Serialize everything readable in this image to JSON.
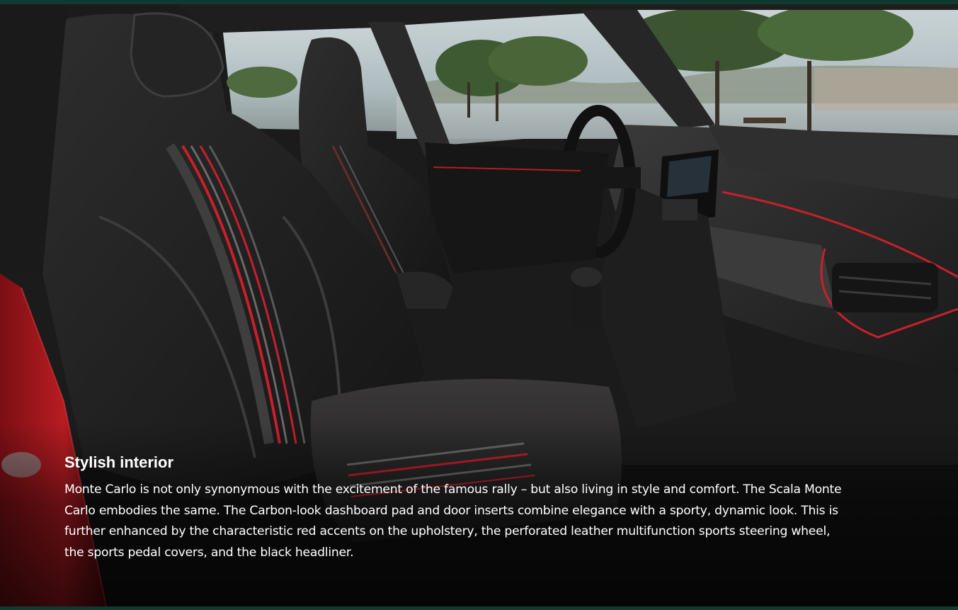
{
  "image": {
    "alt": "Skoda Scala Monte Carlo interior"
  },
  "caption": {
    "title": "Stylish interior",
    "body": "Monte Carlo is not only synonymous with the excitement of the famous rally – but also living in style and comfort. The Scala Monte Carlo embodies the same. The Carbon-look dashboard pad and door inserts combine elegance with a sporty, dynamic look. This is further enhanced by the characteristic red accents on the upholstery, the perforated leather multifunction sports steering wheel, the sports pedal covers, and the black headliner."
  },
  "colors": {
    "frame": "#0e3a2f",
    "accent_red": "#c8202a",
    "text": "#ffffff"
  }
}
